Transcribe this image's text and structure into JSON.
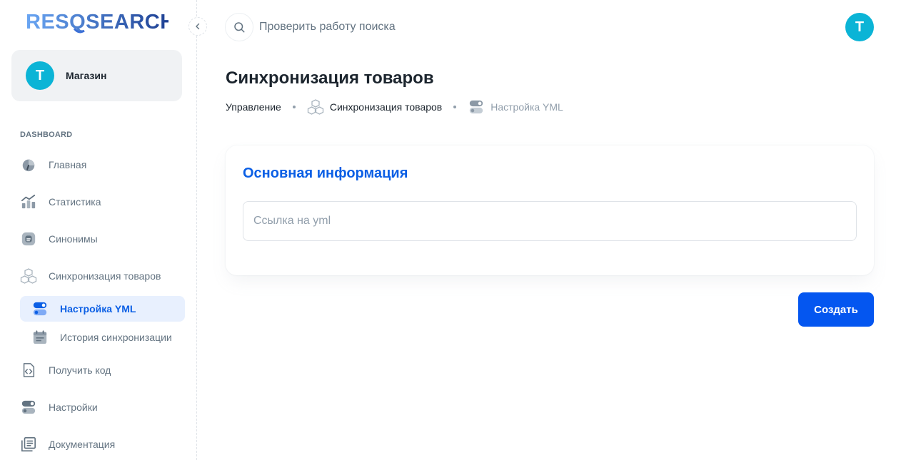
{
  "brand": {
    "logo_text": "RESQSEARCH"
  },
  "account": {
    "avatar_letter": "T",
    "name": "Магазин"
  },
  "sidebar": {
    "section_title": "DASHBOARD",
    "items": [
      {
        "label": "Главная",
        "icon": "dashboard-gauge-icon"
      },
      {
        "label": "Статистика",
        "icon": "analytics-chart-icon"
      },
      {
        "label": "Синонимы",
        "icon": "blog-icon"
      },
      {
        "label": "Синхронизация товаров",
        "icon": "boxes-icon"
      },
      {
        "label": "Настройка YML",
        "icon": "toggle-settings-icon",
        "active": true
      },
      {
        "label": "История синхронизации",
        "icon": "calendar-icon"
      },
      {
        "label": "Получить код",
        "icon": "code-file-icon"
      },
      {
        "label": "Настройки",
        "icon": "toggle-settings-icon"
      },
      {
        "label": "Документация",
        "icon": "docs-icon"
      }
    ]
  },
  "header": {
    "search_text": "Проверить работу поиска",
    "avatar_letter": "T"
  },
  "page": {
    "title": "Синхронизация товаров",
    "breadcrumb": [
      "Управление",
      "Синхронизация товаров",
      "Настройка YML"
    ]
  },
  "card": {
    "title": "Основная информация",
    "input_placeholder": "Ссылка на yml",
    "input_value": ""
  },
  "actions": {
    "create_label": "Создать"
  },
  "colors": {
    "accent": "#0456f0",
    "accent_text": "#0b5fe5",
    "avatar": "#0bb4d6",
    "muted_text": "#637381",
    "active_bg": "#e8f0fe"
  }
}
